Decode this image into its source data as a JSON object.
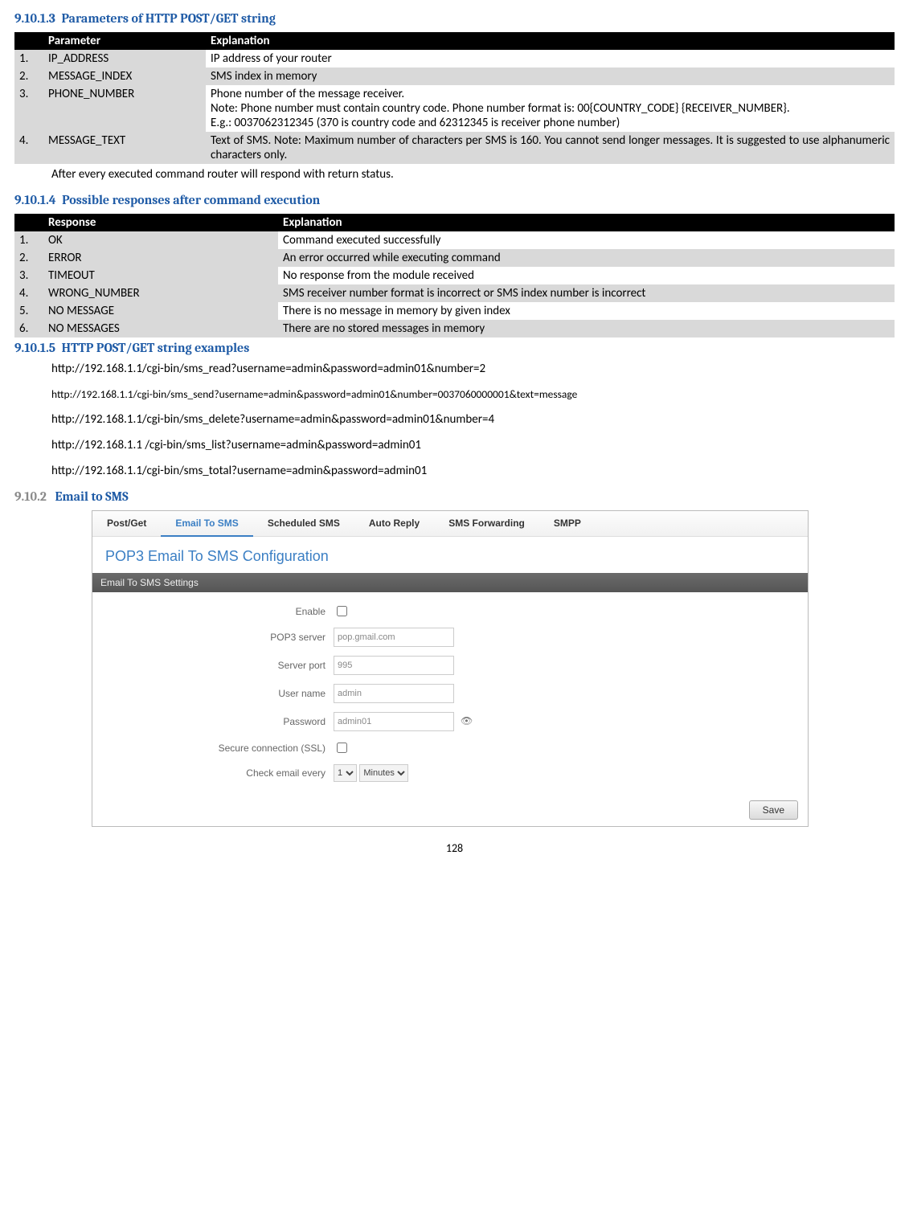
{
  "headings": {
    "h1": {
      "num": "9.10.1.3",
      "text": "Parameters of HTTP POST/GET string"
    },
    "h2": {
      "num": "9.10.1.4",
      "text": "Possible responses after command execution"
    },
    "h3": {
      "num": "9.10.1.5",
      "text": "HTTP POST/GET string examples"
    },
    "h4": {
      "num": "9.10.2",
      "text": "Email to SMS"
    }
  },
  "table1": {
    "headers": {
      "param": "Parameter",
      "exp": "Explanation"
    },
    "rows": [
      {
        "n": "1.",
        "param": "IP_ADDRESS",
        "exp": "IP address of your router"
      },
      {
        "n": "2.",
        "param": "MESSAGE_INDEX",
        "exp": "SMS index in memory"
      },
      {
        "n": "3.",
        "param": "PHONE_NUMBER",
        "exp": "Phone number of the message receiver.\nNote: Phone number must contain country code. Phone number format is: 00{COUNTRY_CODE} {RECEIVER_NUMBER}.\nE.g.: 0037062312345 (370 is country code and 62312345 is receiver phone number)"
      },
      {
        "n": "4.",
        "param": "MESSAGE_TEXT",
        "exp": "Text of SMS. Note: Maximum number of characters per SMS is 160. You cannot send longer messages. It is suggested to use alphanumeric characters only."
      }
    ]
  },
  "post_table1_note": "After every executed command router will respond with return status.",
  "table2": {
    "headers": {
      "resp": "Response",
      "exp": "Explanation"
    },
    "rows": [
      {
        "n": "1.",
        "resp": "OK",
        "exp": "Command executed successfully"
      },
      {
        "n": "2.",
        "resp": "ERROR",
        "exp": "An error occurred while executing command"
      },
      {
        "n": "3.",
        "resp": "TIMEOUT",
        "exp": "No response from the module received"
      },
      {
        "n": "4.",
        "resp": "WRONG_NUMBER",
        "exp": "SMS receiver number format is incorrect or SMS index number is incorrect"
      },
      {
        "n": "5.",
        "resp": "NO MESSAGE",
        "exp": "There is no message in memory by given index"
      },
      {
        "n": "6.",
        "resp": "NO MESSAGES",
        "exp": "There are no stored messages in memory"
      }
    ]
  },
  "examples": [
    "http://192.168.1.1/cgi-bin/sms_read?username=admin&password=admin01&number=2",
    "http://192.168.1.1/cgi-bin/sms_send?username=admin&password=admin01&number=0037060000001&text=message",
    "http://192.168.1.1/cgi-bin/sms_delete?username=admin&password=admin01&number=4",
    "http://192.168.1.1 /cgi-bin/sms_list?username=admin&password=admin01",
    "http://192.168.1.1/cgi-bin/sms_total?username=admin&password=admin01"
  ],
  "ui": {
    "tabs": [
      "Post/Get",
      "Email To SMS",
      "Scheduled SMS",
      "Auto Reply",
      "SMS Forwarding",
      "SMPP"
    ],
    "active_tab": 1,
    "panel_title": "POP3 Email To SMS Configuration",
    "section_bar": "Email To SMS Settings",
    "labels": {
      "enable": "Enable",
      "pop3": "POP3 server",
      "port": "Server port",
      "user": "User name",
      "pass": "Password",
      "ssl": "Secure connection (SSL)",
      "check": "Check email every"
    },
    "values": {
      "pop3": "pop.gmail.com",
      "port": "995",
      "user": "admin",
      "pass": "admin01",
      "check_num": "1",
      "check_unit": "Minutes"
    },
    "save_btn": "Save"
  },
  "page_number": "128"
}
